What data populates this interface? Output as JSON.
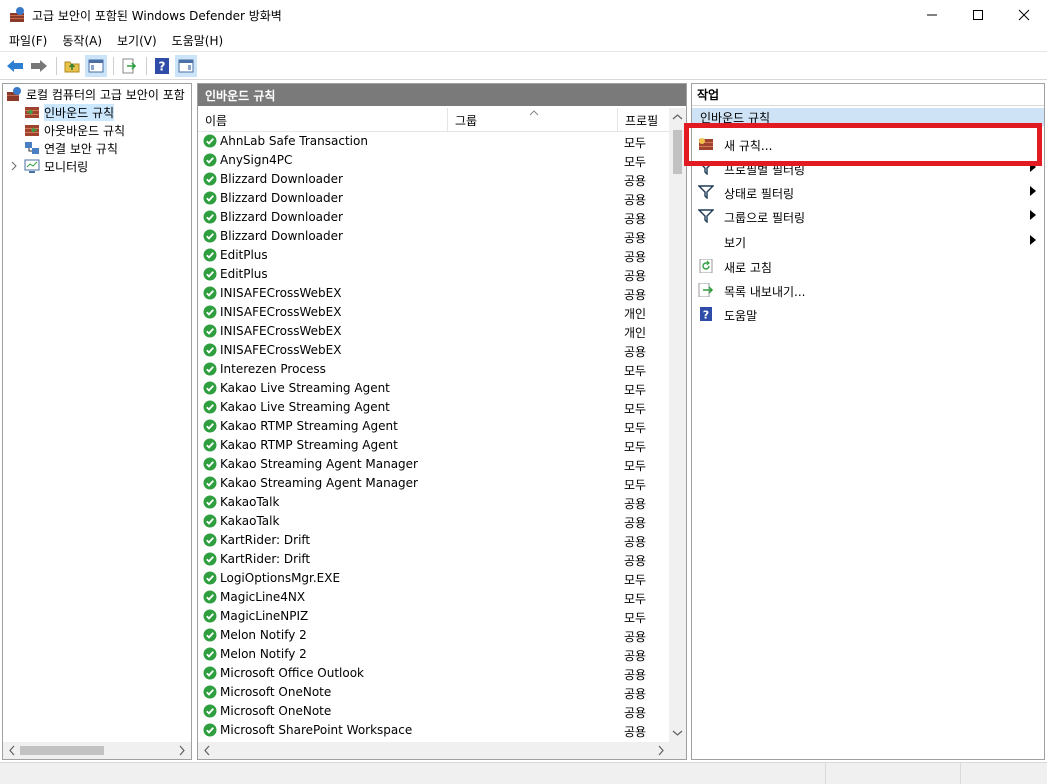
{
  "window": {
    "title": "고급 보안이 포함된 Windows Defender 방화벽"
  },
  "menu": [
    {
      "label": "파일(F)"
    },
    {
      "label": "동작(A)"
    },
    {
      "label": "보기(V)"
    },
    {
      "label": "도움말(H)"
    }
  ],
  "tree": {
    "root": "로컬 컴퓨터의 고급 보안이 포함",
    "items": [
      {
        "label": "인바운드 규칙",
        "selected": true
      },
      {
        "label": "아웃바운드 규칙"
      },
      {
        "label": "연결 보안 규칙"
      },
      {
        "label": "모니터링"
      }
    ]
  },
  "center": {
    "header": "인바운드 규칙",
    "columns": {
      "name": "이름",
      "group": "그룹",
      "profile": "프로필"
    },
    "rows": [
      {
        "name": "AhnLab Safe Transaction",
        "profile": "모두"
      },
      {
        "name": "AnySign4PC",
        "profile": "모두"
      },
      {
        "name": "Blizzard Downloader",
        "profile": "공용"
      },
      {
        "name": "Blizzard Downloader",
        "profile": "공용"
      },
      {
        "name": "Blizzard Downloader",
        "profile": "공용"
      },
      {
        "name": "Blizzard Downloader",
        "profile": "공용"
      },
      {
        "name": "EditPlus",
        "profile": "공용"
      },
      {
        "name": "EditPlus",
        "profile": "공용"
      },
      {
        "name": "INISAFECrossWebEX",
        "profile": "공용"
      },
      {
        "name": "INISAFECrossWebEX",
        "profile": "개인"
      },
      {
        "name": "INISAFECrossWebEX",
        "profile": "개인"
      },
      {
        "name": "INISAFECrossWebEX",
        "profile": "공용"
      },
      {
        "name": "Interezen Process",
        "profile": "모두"
      },
      {
        "name": "Kakao Live Streaming Agent",
        "profile": "모두"
      },
      {
        "name": "Kakao Live Streaming Agent",
        "profile": "모두"
      },
      {
        "name": "Kakao RTMP Streaming Agent",
        "profile": "모두"
      },
      {
        "name": "Kakao RTMP Streaming Agent",
        "profile": "모두"
      },
      {
        "name": "Kakao Streaming Agent Manager",
        "profile": "모두"
      },
      {
        "name": "Kakao Streaming Agent Manager",
        "profile": "모두"
      },
      {
        "name": "KakaoTalk",
        "profile": "공용"
      },
      {
        "name": "KakaoTalk",
        "profile": "공용"
      },
      {
        "name": "KartRider: Drift",
        "profile": "공용"
      },
      {
        "name": "KartRider: Drift",
        "profile": "공용"
      },
      {
        "name": "LogiOptionsMgr.EXE",
        "profile": "모두"
      },
      {
        "name": "MagicLine4NX",
        "profile": "모두"
      },
      {
        "name": "MagicLineNPIZ",
        "profile": "모두"
      },
      {
        "name": "Melon Notify 2",
        "profile": "공용"
      },
      {
        "name": "Melon Notify 2",
        "profile": "공용"
      },
      {
        "name": "Microsoft Office Outlook",
        "profile": "공용"
      },
      {
        "name": "Microsoft OneNote",
        "profile": "공용"
      },
      {
        "name": "Microsoft OneNote",
        "profile": "공용"
      },
      {
        "name": "Microsoft SharePoint Workspace",
        "profile": "공용"
      }
    ]
  },
  "actions": {
    "header": "작업",
    "section": "인바운드 규칙",
    "items": [
      {
        "label": "새 규칙...",
        "icon": "new-rule-icon",
        "submenu": false
      },
      {
        "label": "프로필별 필터링",
        "icon": "filter-icon",
        "submenu": true
      },
      {
        "label": "상태로 필터링",
        "icon": "filter-icon",
        "submenu": true
      },
      {
        "label": "그룹으로 필터링",
        "icon": "filter-icon",
        "submenu": true
      },
      {
        "label": "보기",
        "icon": "",
        "submenu": true
      },
      {
        "label": "새로 고침",
        "icon": "refresh-icon",
        "submenu": false
      },
      {
        "label": "목록 내보내기...",
        "icon": "export-list-icon",
        "submenu": false
      },
      {
        "label": "도움말",
        "icon": "help-icon",
        "submenu": false
      }
    ]
  },
  "colors": {
    "highlight": "#e21b23",
    "header_gray": "#7a7a7a",
    "selection": "#cce8ff",
    "section_blue": "#cfe3f7",
    "check_green": "#2e9e3e"
  }
}
